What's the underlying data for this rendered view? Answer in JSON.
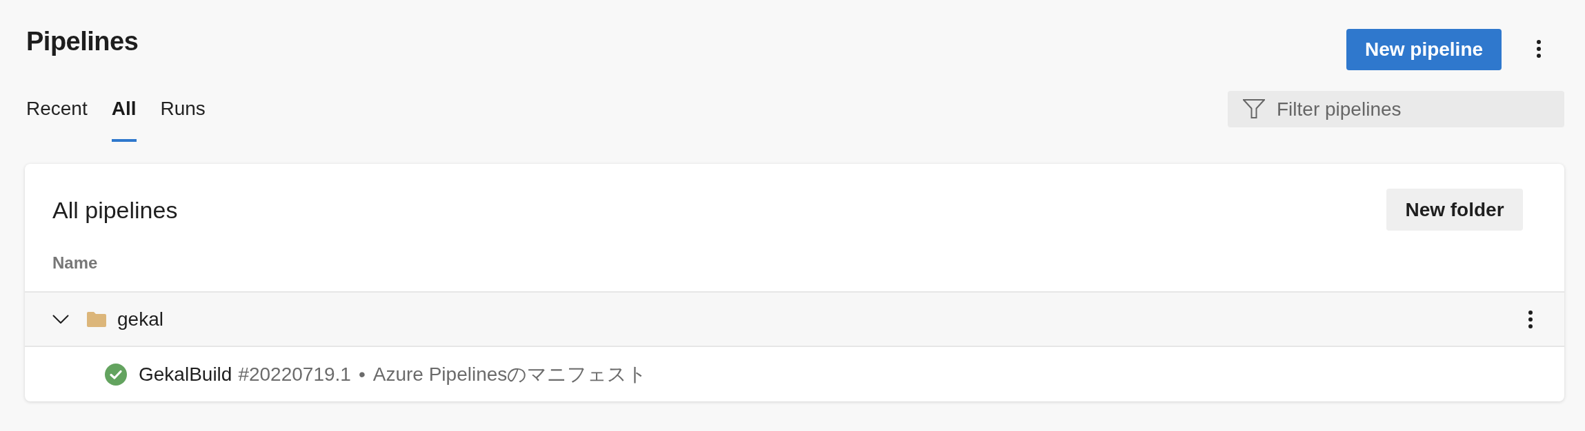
{
  "header": {
    "title": "Pipelines",
    "new_button": "New pipeline"
  },
  "tabs": [
    {
      "label": "Recent",
      "selected": false
    },
    {
      "label": "All",
      "selected": true
    },
    {
      "label": "Runs",
      "selected": false
    }
  ],
  "filter": {
    "placeholder": "Filter pipelines"
  },
  "card": {
    "title": "All pipelines",
    "button": "New folder",
    "table": {
      "columns": [
        "Name"
      ],
      "rows": [
        {
          "kind": "folder",
          "name": "gekal",
          "expanded": true,
          "children": [
            {
              "kind": "pipeline",
              "name": "GekalBuild",
              "run": "#20220719.1",
              "separator": "•",
              "description": "Azure Pipelinesのマニフェスト",
              "succeeded": true
            }
          ]
        }
      ]
    }
  }
}
